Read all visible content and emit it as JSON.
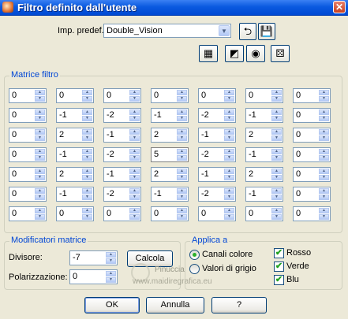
{
  "window": {
    "title": "Filtro definito dall'utente",
    "close_glyph": "✕"
  },
  "preset": {
    "label": "Imp. predef.:",
    "value": "Double_Vision"
  },
  "toolbar_icons": [
    "restore-icon",
    "save-icon",
    "film-icon",
    "mask-icon",
    "eye-icon",
    "dice-icon"
  ],
  "matrix": {
    "title": "Matrice filtro",
    "rows": [
      [
        "0",
        "0",
        "0",
        "0",
        "0",
        "0",
        "0"
      ],
      [
        "0",
        "-1",
        "-2",
        "-1",
        "-2",
        "-1",
        "0"
      ],
      [
        "0",
        "2",
        "-1",
        "2",
        "-1",
        "2",
        "0"
      ],
      [
        "0",
        "-1",
        "-2",
        "5",
        "-2",
        "-1",
        "0"
      ],
      [
        "0",
        "2",
        "-1",
        "2",
        "-1",
        "2",
        "0"
      ],
      [
        "0",
        "-1",
        "-2",
        "-1",
        "-2",
        "-1",
        "0"
      ],
      [
        "0",
        "0",
        "0",
        "0",
        "0",
        "0",
        "0"
      ]
    ]
  },
  "modifiers": {
    "title": "Modificatori matrice",
    "divisor_label": "Divisore:",
    "divisor_value": "-7",
    "bias_label": "Polarizzazione:",
    "bias_value": "0",
    "calc_label": "Calcola"
  },
  "apply": {
    "title": "Applica a",
    "radio_color": "Canali colore",
    "radio_gray": "Valori di grigio",
    "check_red": "Rosso",
    "check_green": "Verde",
    "check_blue": "Blu"
  },
  "buttons": {
    "ok": "OK",
    "cancel": "Annulla",
    "help": "?"
  },
  "watermark": {
    "name": "Pinuccia",
    "site": "www.maidiregrafica.eu"
  }
}
